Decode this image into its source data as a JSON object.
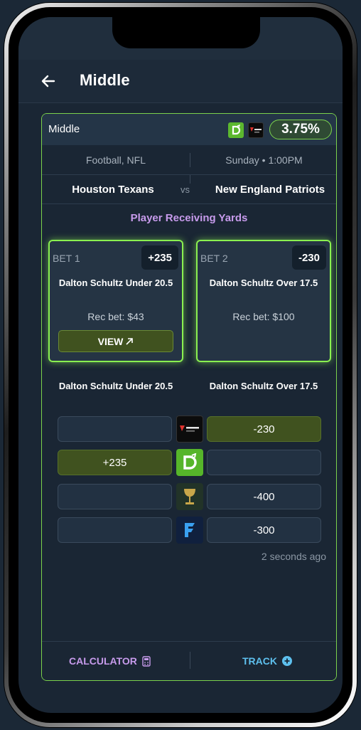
{
  "header": {
    "title": "Middle"
  },
  "card": {
    "label": "Middle",
    "percentage": "3.75%",
    "sport": "Football, NFL",
    "time": "Sunday • 1:00PM",
    "team_home": "Houston Texans",
    "vs": "vs",
    "team_away": "New England Patriots",
    "market": "Player Receiving Yards"
  },
  "bets": [
    {
      "label": "BET 1",
      "odds": "+235",
      "selection": "Dalton Schultz Under 20.5",
      "rec_bet": "Rec bet: $43",
      "view_label": "VIEW"
    },
    {
      "label": "BET 2",
      "odds": "-230",
      "selection": "Dalton Schultz Over 17.5",
      "rec_bet": "Rec bet: $100"
    }
  ],
  "compare": {
    "left_header": "Dalton Schultz Under 20.5",
    "right_header": "Dalton Schultz Over 17.5",
    "rows": [
      {
        "book": "fanatics",
        "left": "",
        "right": "-230",
        "best": "right"
      },
      {
        "book": "draftkings",
        "left": "+235",
        "right": "",
        "best": "left"
      },
      {
        "book": "grail",
        "left": "",
        "right": "-400",
        "best": ""
      },
      {
        "book": "fliff",
        "left": "",
        "right": "-300",
        "best": ""
      }
    ],
    "updated": "2 seconds ago"
  },
  "footer": {
    "calculator_label": "CALCULATOR",
    "track_label": "TRACK"
  },
  "colors": {
    "accent_green": "#8af050",
    "purple": "#c79bec",
    "blue": "#5ec0ee",
    "bg": "#1a2634"
  },
  "icons": [
    "back-arrow-icon",
    "draftkings-icon",
    "fanatics-icon",
    "external-link-icon",
    "grail-icon",
    "fliff-icon",
    "calculator-icon",
    "plus-circle-icon"
  ]
}
